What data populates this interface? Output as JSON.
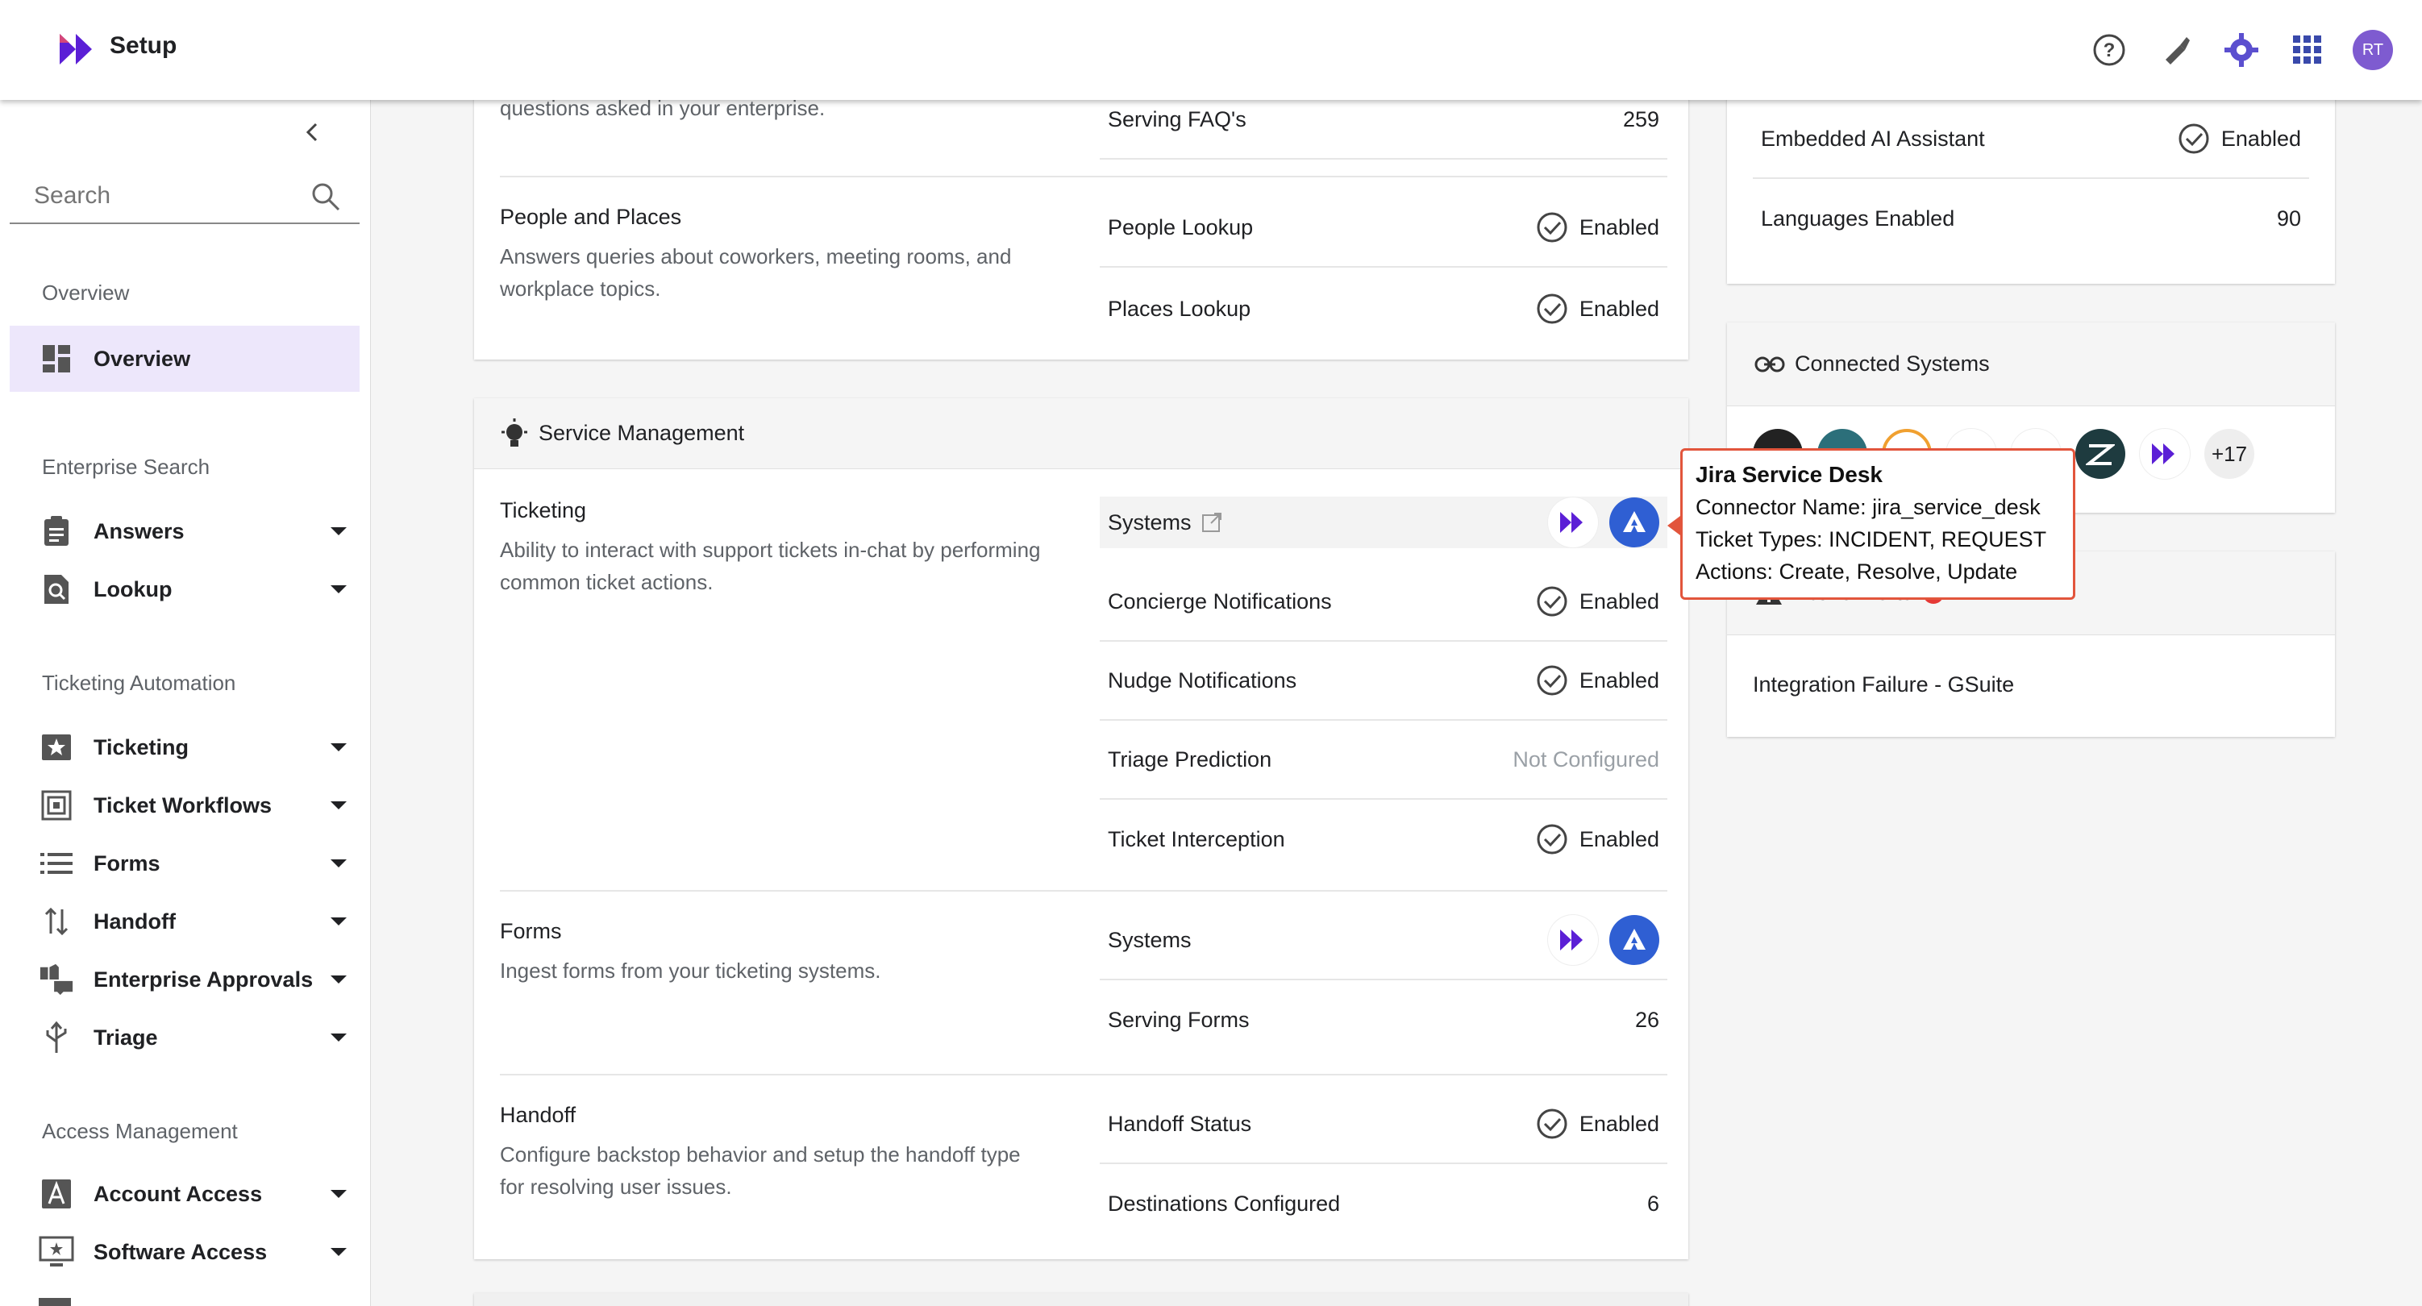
{
  "app": {
    "title": "Setup"
  },
  "topbar": {
    "avatar_initials": "RT",
    "icons": [
      "help-icon",
      "brush-icon",
      "settings-icon",
      "apps-grid-icon"
    ]
  },
  "sidebar": {
    "search_placeholder": "Search",
    "sections": {
      "overview": "Overview",
      "enterprise_search": "Enterprise Search",
      "ticketing_automation": "Ticketing Automation",
      "access_management": "Access Management"
    },
    "items": {
      "overview": "Overview",
      "answers": "Answers",
      "lookup": "Lookup",
      "ticketing": "Ticketing",
      "ticket_workflows": "Ticket Workflows",
      "forms": "Forms",
      "handoff": "Handoff",
      "enterprise_approvals": "Enterprise Approvals",
      "triage": "Triage",
      "account_access": "Account Access",
      "software_access": "Software Access"
    }
  },
  "answers_card": {
    "partial_desc": "questions asked in your enterprise.",
    "serving_faqs": {
      "label": "Serving FAQ's",
      "value": "259"
    },
    "people_places": {
      "title": "People and Places",
      "desc": "Answers queries about coworkers, meeting rooms, and workplace topics.",
      "people_lookup": {
        "label": "People Lookup",
        "value": "Enabled"
      },
      "places_lookup": {
        "label": "Places Lookup",
        "value": "Enabled"
      }
    }
  },
  "service_management": {
    "header": "Service Management",
    "ticketing": {
      "title": "Ticketing",
      "desc": "Ability to interact with support tickets in-chat by performing common ticket actions.",
      "systems_label": "Systems",
      "concierge": {
        "label": "Concierge Notifications",
        "value": "Enabled"
      },
      "nudge": {
        "label": "Nudge Notifications",
        "value": "Enabled"
      },
      "triage": {
        "label": "Triage Prediction",
        "value": "Not Configured"
      },
      "interception": {
        "label": "Ticket Interception",
        "value": "Enabled"
      }
    },
    "forms": {
      "title": "Forms",
      "desc": "Ingest forms from your ticketing systems.",
      "systems_label": "Systems",
      "serving_forms": {
        "label": "Serving Forms",
        "value": "26"
      }
    },
    "handoff": {
      "title": "Handoff",
      "desc": "Configure backstop behavior and setup the handoff type for resolving user issues.",
      "status": {
        "label": "Handoff Status",
        "value": "Enabled"
      },
      "destinations": {
        "label": "Destinations Configured",
        "value": "6"
      }
    }
  },
  "right_panel": {
    "embedded_ai": {
      "label": "Embedded AI Assistant",
      "value": "Enabled"
    },
    "languages": {
      "label": "Languages Enabled",
      "value": "90"
    },
    "connected_systems": {
      "header": "Connected Systems",
      "more": "+17"
    },
    "active_alerts": {
      "header": "Active Alerts",
      "item": "Integration Failure - GSuite"
    }
  },
  "tooltip": {
    "title": "Jira Service Desk",
    "connector": "Connector Name: jira_service_desk",
    "ticket_types": "Ticket Types: INCIDENT, REQUEST",
    "actions": "Actions: Create, Resolve, Update"
  },
  "colors": {
    "brand": "#5b1fd6",
    "jira": "#2f5fd3",
    "accent_bg": "#ede7fb",
    "tooltip_border": "#e2553c"
  }
}
